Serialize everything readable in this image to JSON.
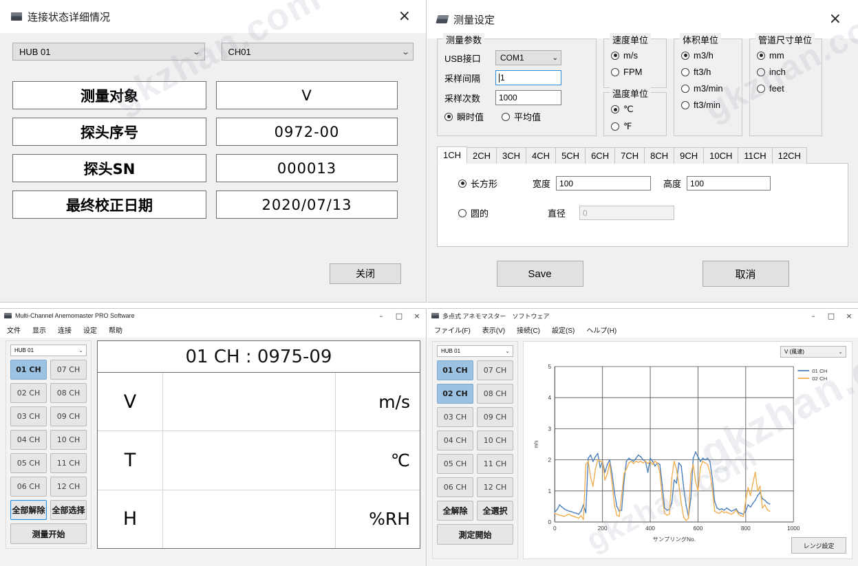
{
  "panel1": {
    "title": "连接状态详细情况",
    "close_icon": "×",
    "hub_select": "HUB 01",
    "ch_select": "CH01",
    "rows": [
      {
        "key": "测量对象",
        "value": "V"
      },
      {
        "key": "探头序号",
        "value": "0972-00"
      },
      {
        "key": "探头SN",
        "value": "000013"
      },
      {
        "key": "最终校正日期",
        "value": "2020/07/13"
      }
    ],
    "close_button": "关闭"
  },
  "panel2": {
    "title": "测量设定",
    "close_icon": "×",
    "params_group": {
      "legend": "测量参数",
      "usb_label": "USB接口",
      "usb_value": "COM1",
      "interval_label": "采样间隔",
      "interval_value": "1",
      "count_label": "采样次数",
      "count_value": "1000",
      "mode_instant": "瞬时值",
      "mode_average": "平均值",
      "mode_selected": "瞬时值"
    },
    "speed_group": {
      "legend": "速度单位",
      "options": [
        "m/s",
        "FPM"
      ],
      "selected": "m/s"
    },
    "temp_group": {
      "legend": "温度单位",
      "options": [
        "℃",
        "℉"
      ],
      "selected": "℃"
    },
    "volume_group": {
      "legend": "体积单位",
      "options": [
        "m3/h",
        "ft3/h",
        "m3/min",
        "ft3/min"
      ],
      "selected": "m3/h"
    },
    "pipe_group": {
      "legend": "管道尺寸单位",
      "options": [
        "mm",
        "inch",
        "feet"
      ],
      "selected": "mm"
    },
    "tabs": [
      "1CH",
      "2CH",
      "3CH",
      "4CH",
      "5CH",
      "6CH",
      "7CH",
      "8CH",
      "9CH",
      "10CH",
      "11CH",
      "12CH"
    ],
    "active_tab": "1CH",
    "shape": {
      "rect_label": "长方形",
      "width_label": "宽度",
      "width_value": "100",
      "height_label": "高度",
      "height_value": "100",
      "circle_label": "圆的",
      "diameter_label": "直径",
      "diameter_value": "0",
      "selected": "长方形"
    },
    "save_button": "Save",
    "cancel_button": "取消"
  },
  "panel3": {
    "title": "Multi-Channel Anemomaster PRO Software",
    "window_buttons": {
      "minimize": "–",
      "maximize": "□",
      "close": "×"
    },
    "menu": [
      "文件",
      "显示",
      "连接",
      "设定",
      "帮助"
    ],
    "hub_select": "HUB 01",
    "channels": [
      "01 CH",
      "02 CH",
      "03 CH",
      "04 CH",
      "05 CH",
      "06 CH",
      "07 CH",
      "08 CH",
      "09 CH",
      "10 CH",
      "11 CH",
      "12 CH"
    ],
    "selected_channels": [
      "01 CH"
    ],
    "deselect_all": "全部解除",
    "select_all": "全部选择",
    "start_button": "测量开始",
    "readout_title": "01 CH : 0975-09",
    "readout_rows": [
      {
        "symbol": "V",
        "value": "",
        "unit": "m/s"
      },
      {
        "symbol": "T",
        "value": "",
        "unit": "℃"
      },
      {
        "symbol": "H",
        "value": "",
        "unit": "%RH"
      }
    ]
  },
  "panel4": {
    "title": "多点式 アネモマスター　ソフトウェア",
    "window_buttons": {
      "minimize": "–",
      "maximize": "□",
      "close": "×"
    },
    "menu": [
      "ファイル(F)",
      "表示(V)",
      "接続(C)",
      "設定(S)",
      "ヘルプ(H)"
    ],
    "hub_select": "HUB 01",
    "channels": [
      "01 CH",
      "02 CH",
      "03 CH",
      "04 CH",
      "05 CH",
      "06 CH",
      "07 CH",
      "08 CH",
      "09 CH",
      "10 CH",
      "11 CH",
      "12 CH"
    ],
    "selected_channels": [
      "01 CH",
      "02 CH"
    ],
    "deselect_all": "全解除",
    "select_all": "全選択",
    "start_button": "測定開始",
    "quantity_select": "V (風速)",
    "range_button": "レンジ設定"
  },
  "chart_data": {
    "type": "line",
    "title": "",
    "xlabel": "サンプリングNo.",
    "ylabel": "m/s",
    "xlim": [
      0,
      1000
    ],
    "ylim": [
      0,
      5
    ],
    "xticks": [
      0,
      200,
      400,
      600,
      800,
      1000
    ],
    "yticks": [
      0,
      1,
      2,
      3,
      4,
      5
    ],
    "grid": true,
    "legend_position": "top-right",
    "colors": {
      "01 CH": "#4a7ebb",
      "02 CH": "#f0ad4e"
    },
    "series": [
      {
        "name": "01 CH",
        "color": "#4a7ebb",
        "x": [
          0,
          10,
          20,
          30,
          40,
          50,
          60,
          70,
          80,
          90,
          100,
          110,
          120,
          130,
          140,
          150,
          160,
          170,
          180,
          190,
          200,
          210,
          220,
          230,
          240,
          250,
          260,
          270,
          280,
          290,
          300,
          310,
          320,
          330,
          340,
          350,
          360,
          370,
          380,
          390,
          400,
          410,
          420,
          430,
          440,
          450,
          460,
          470,
          480,
          490,
          500,
          510,
          520,
          530,
          540,
          550,
          560,
          570,
          580,
          590,
          600,
          610,
          620,
          630,
          640,
          650,
          660,
          670,
          680,
          690,
          700,
          710,
          720,
          730,
          740,
          750,
          760,
          770,
          780,
          790,
          800,
          810,
          820,
          830,
          840,
          850,
          860,
          870,
          880,
          890,
          900
        ],
        "values": [
          0.32,
          0.4,
          0.55,
          0.48,
          0.42,
          0.38,
          0.35,
          0.33,
          0.3,
          0.28,
          0.25,
          0.35,
          0.55,
          0.3,
          2.05,
          2.15,
          1.95,
          2.1,
          2.2,
          1.75,
          1.95,
          1.6,
          1.85,
          2.0,
          1.55,
          0.95,
          0.5,
          0.35,
          0.38,
          1.3,
          1.95,
          2.05,
          2.0,
          1.95,
          2.05,
          2.15,
          2.1,
          2.0,
          1.95,
          1.6,
          2.05,
          1.95,
          1.8,
          1.9,
          1.85,
          1.2,
          0.45,
          0.38,
          0.4,
          0.6,
          1.35,
          1.25,
          1.9,
          1.8,
          1.1,
          0.55,
          0.18,
          0.75,
          2.05,
          2.25,
          2.1,
          1.95,
          2.05,
          2.0,
          2.05,
          1.95,
          1.4,
          0.65,
          0.45,
          0.4,
          0.42,
          0.38,
          0.45,
          0.4,
          0.35,
          0.38,
          0.42,
          0.3,
          0.28,
          0.25,
          0.35,
          0.55,
          0.48,
          0.6,
          0.7,
          0.85,
          0.95,
          0.75,
          0.7,
          0.62,
          0.58
        ]
      },
      {
        "name": "02 CH",
        "color": "#f0ad4e",
        "x": [
          0,
          10,
          20,
          30,
          40,
          50,
          60,
          70,
          80,
          90,
          100,
          110,
          120,
          130,
          140,
          150,
          160,
          170,
          180,
          190,
          200,
          210,
          220,
          230,
          240,
          250,
          260,
          270,
          280,
          290,
          300,
          310,
          320,
          330,
          340,
          350,
          360,
          370,
          380,
          390,
          400,
          410,
          420,
          430,
          440,
          450,
          460,
          470,
          480,
          490,
          500,
          510,
          520,
          530,
          540,
          550,
          560,
          570,
          580,
          590,
          600,
          610,
          620,
          630,
          640,
          650,
          660,
          670,
          680,
          690,
          700,
          710,
          720,
          730,
          740,
          750,
          760,
          770,
          780,
          790,
          800,
          810,
          820,
          830,
          840,
          850,
          860,
          870,
          880,
          890,
          900
        ],
        "values": [
          0.28,
          0.25,
          0.22,
          0.2,
          0.18,
          0.22,
          0.25,
          0.2,
          0.18,
          0.15,
          0.12,
          0.2,
          0.08,
          1.85,
          1.95,
          1.45,
          1.15,
          1.7,
          2.0,
          1.95,
          1.95,
          1.35,
          1.55,
          1.9,
          1.25,
          0.55,
          0.22,
          0.18,
          0.85,
          1.55,
          1.7,
          1.9,
          1.95,
          1.88,
          1.95,
          1.92,
          1.95,
          1.9,
          1.95,
          1.88,
          1.95,
          1.85,
          1.95,
          1.9,
          1.6,
          0.8,
          0.28,
          0.22,
          0.25,
          1.4,
          1.95,
          1.7,
          1.2,
          0.6,
          0.15,
          0.05,
          0.12,
          1.55,
          1.85,
          1.3,
          1.0,
          1.75,
          1.95,
          1.9,
          1.85,
          1.6,
          1.05,
          0.35,
          0.3,
          0.28,
          0.35,
          0.3,
          0.32,
          0.28,
          0.25,
          0.3,
          0.38,
          0.25,
          0.2,
          0.18,
          0.7,
          1.1,
          0.85,
          1.25,
          1.6,
          1.0,
          1.15,
          0.45,
          0.55,
          0.4,
          0.35
        ]
      }
    ]
  },
  "watermarks": [
    "gkzhan.com",
    "gkzhan.com",
    "gkzhan.com",
    "gkzhan.com"
  ]
}
